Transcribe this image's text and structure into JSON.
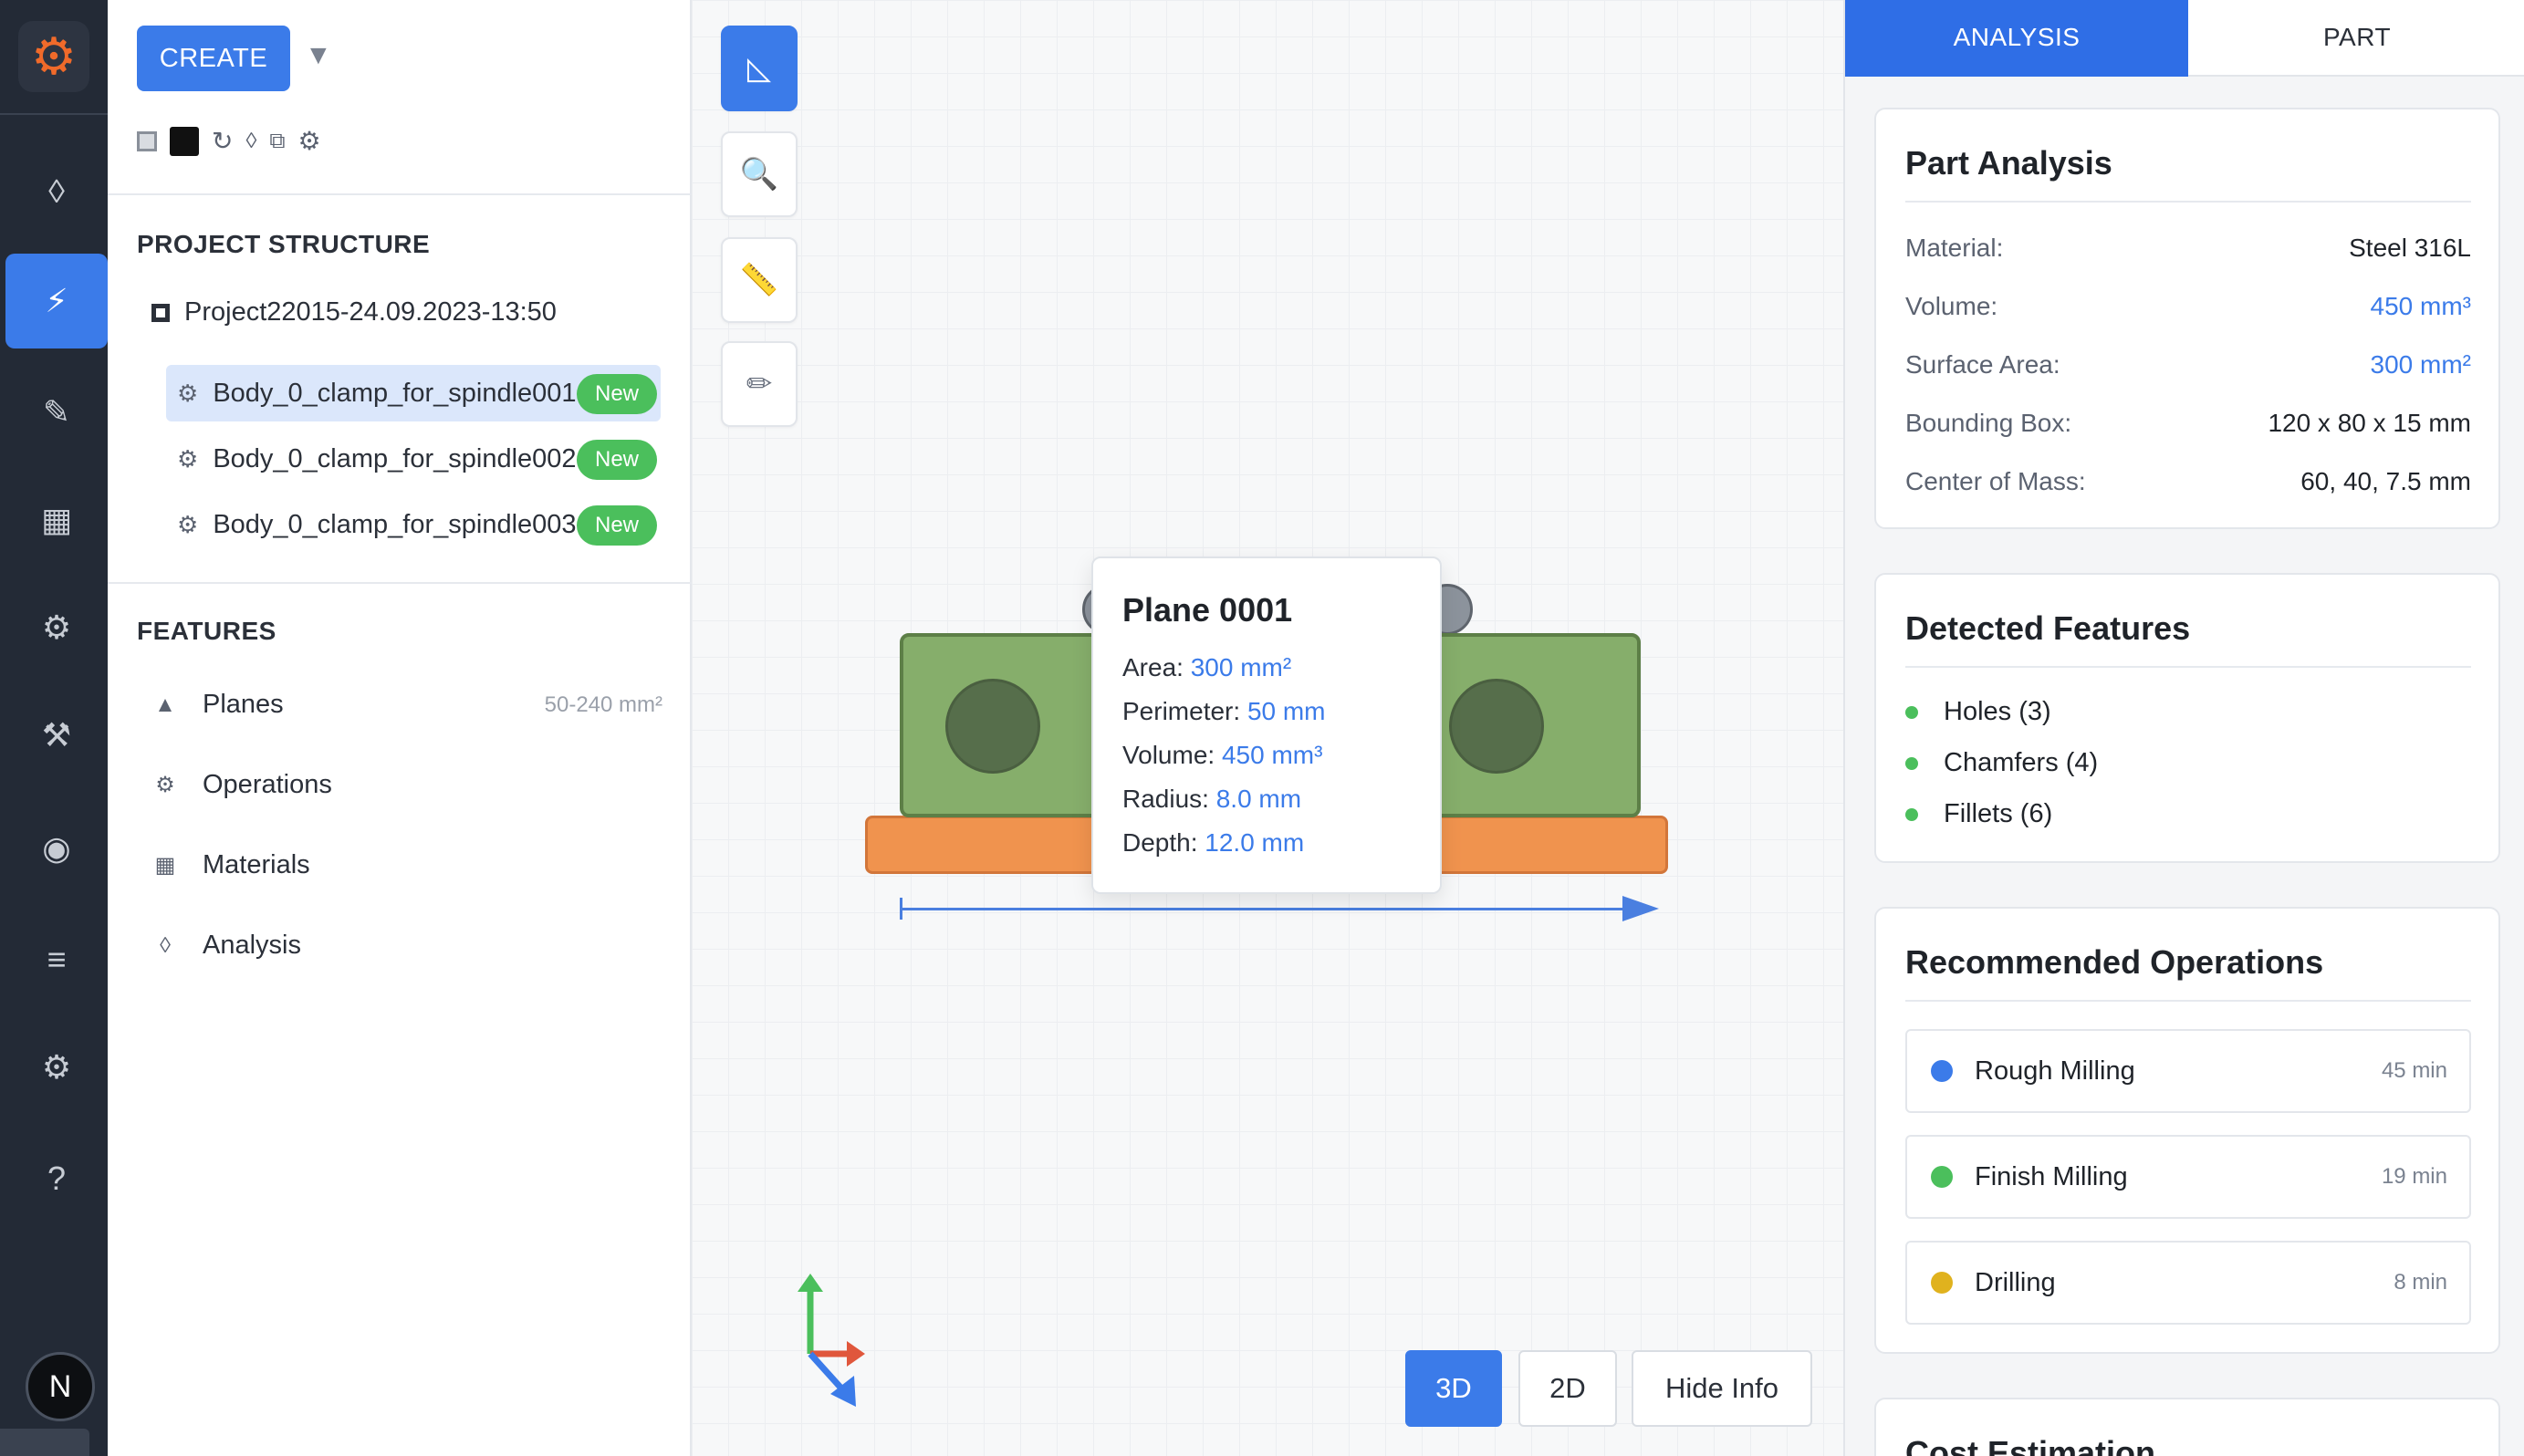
{
  "rail": {
    "items": [
      {
        "name": "rail-item-diamond",
        "glyph": "◊"
      },
      {
        "name": "rail-item-lightning",
        "glyph": "⚡"
      },
      {
        "name": "rail-item-pencil",
        "glyph": "✎"
      },
      {
        "name": "rail-item-grid",
        "glyph": "▦"
      },
      {
        "name": "rail-item-gear",
        "glyph": "⚙"
      },
      {
        "name": "rail-item-tools",
        "glyph": "⚒"
      },
      {
        "name": "rail-item-record",
        "glyph": "◉"
      },
      {
        "name": "rail-item-menu",
        "glyph": "≡"
      },
      {
        "name": "rail-item-settings",
        "glyph": "⚙"
      },
      {
        "name": "rail-item-help",
        "glyph": "?"
      }
    ],
    "avatar_letter": "N"
  },
  "toolbar": {
    "create_label": "CREATE",
    "caret": "▼"
  },
  "project": {
    "section_title": "PROJECT STRUCTURE",
    "root_name": "Project22015-24.09.2023-13:50",
    "bodies": [
      {
        "label": "Body_0_clamp_for_spindle001",
        "badge": "New"
      },
      {
        "label": "Body_0_clamp_for_spindle002",
        "badge": "New"
      },
      {
        "label": "Body_0_clamp_for_spindle003",
        "badge": "New"
      }
    ]
  },
  "features": {
    "section_title": "FEATURES",
    "items": [
      {
        "label": "Planes",
        "icon": "▲",
        "meta": "50-240 mm²"
      },
      {
        "label": "Operations",
        "icon": "⚙",
        "meta": ""
      },
      {
        "label": "Materials",
        "icon": "▦",
        "meta": ""
      },
      {
        "label": "Analysis",
        "icon": "◊",
        "meta": ""
      }
    ]
  },
  "viewport": {
    "tools": [
      {
        "name": "ruler-angle-tool",
        "glyph": "◺"
      },
      {
        "name": "magnify-tool",
        "glyph": "🔍"
      },
      {
        "name": "measure-tool",
        "glyph": "📏"
      },
      {
        "name": "pencil-tool",
        "glyph": "✏"
      }
    ],
    "tooltip": {
      "title": "Plane 0001",
      "rows": [
        {
          "k": "Area:",
          "v": "300 mm²"
        },
        {
          "k": "Perimeter:",
          "v": "50 mm"
        },
        {
          "k": "Volume:",
          "v": "450 mm³"
        },
        {
          "k": "Radius:",
          "v": "8.0 mm"
        },
        {
          "k": "Depth:",
          "v": "12.0 mm"
        }
      ]
    },
    "view_buttons": {
      "b3d": "3D",
      "b2d": "2D",
      "hide": "Hide Info"
    }
  },
  "right": {
    "tabs": {
      "analysis": "ANALYSIS",
      "part": "PART"
    },
    "part_analysis": {
      "title": "Part Analysis",
      "rows": [
        {
          "k": "Material:",
          "v": "Steel 316L"
        },
        {
          "k": "Volume:",
          "v": "450 mm³"
        },
        {
          "k": "Surface Area:",
          "v": "300 mm²"
        },
        {
          "k": "Bounding Box:",
          "v": "120 x 80 x 15 mm"
        },
        {
          "k": "Center of Mass:",
          "v": "60, 40, 7.5 mm"
        }
      ]
    },
    "detected": {
      "title": "Detected Features",
      "items": [
        "Holes (3)",
        "Chamfers (4)",
        "Fillets (6)"
      ]
    },
    "recommended": {
      "title": "Recommended Operations",
      "items": [
        {
          "label": "Rough Milling",
          "time": "45 min",
          "color": "#3b7be9"
        },
        {
          "label": "Finish Milling",
          "time": "19 min",
          "color": "#4bbf5c"
        },
        {
          "label": "Drilling",
          "time": "8 min",
          "color": "#e0b21e"
        }
      ]
    },
    "cost": {
      "title": "Cost Estimation"
    }
  },
  "colors": {
    "accent": "#3b7be9",
    "success": "#4bbf5c",
    "part_green": "#86ae6b",
    "part_orange": "#f0934e"
  }
}
